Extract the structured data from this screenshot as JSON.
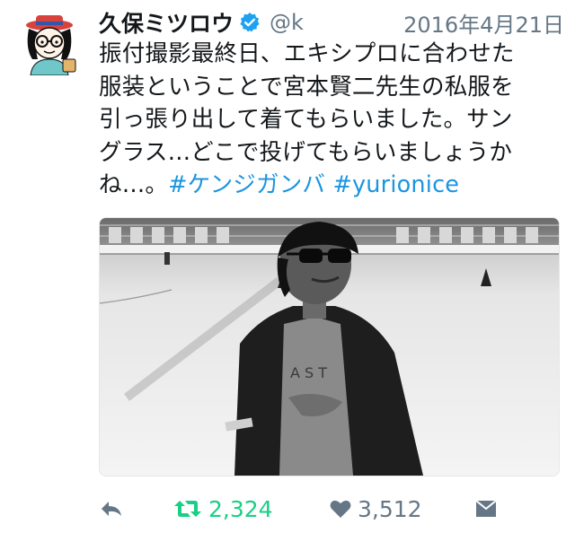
{
  "tweet": {
    "author_name": "久保ミツロウ",
    "handle": "@k",
    "date": "2016年4月21日",
    "text_lines": [
      "振付撮影最終日、エキシプロに合わせた",
      "服装ということで宮本賢二先生の私服を",
      "引っ張り出して着てもらいました。サン",
      "グラス…どこで投げてもらいましょうか"
    ],
    "last_line_text": "ね…。",
    "hashtags": [
      "#ケンジガンバ",
      "#yurionice"
    ]
  },
  "actions": {
    "retweet_count": "2,324",
    "like_count": "3,512"
  },
  "icons": {
    "avatar": "cartoon-avatar-icon",
    "verified": "verified-badge-icon",
    "reply": "reply-icon",
    "retweet": "retweet-icon",
    "like": "heart-icon",
    "dm": "direct-message-icon"
  },
  "colors": {
    "retweet": "#19cf86",
    "hashtag": "#1b95e0",
    "verified": "#1da1f2",
    "muted": "#657786"
  }
}
